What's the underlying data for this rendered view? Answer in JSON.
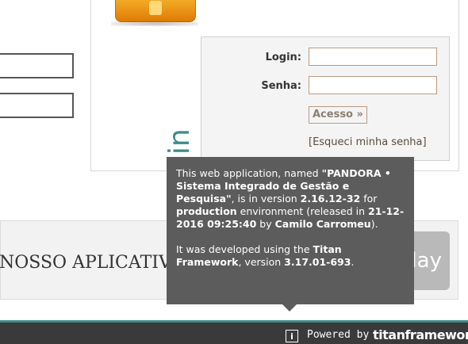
{
  "login_panel": {
    "vertical_title": "login",
    "login_label": "Login:",
    "password_label": "Senha:",
    "login_value": "",
    "password_value": "",
    "access_button": "Acesso »",
    "forgot_link": "[Esqueci minha senha]"
  },
  "band": {
    "text": "NOSSO APLICATIVO",
    "play_label": "lay"
  },
  "tooltip": {
    "t1": "This web application, named ",
    "app_name": "\"PANDORA • Sistema Integrado de Gestão e Pesquisa\"",
    "t2": ", is in version ",
    "version": "2.16.12-32",
    "t3": " for ",
    "environment": "production",
    "t4": " environment (released in ",
    "release_date": "21-12-2016 09:25:40",
    "t5": " by ",
    "author": "Camilo Carromeu",
    "t6": ").",
    "t7": "It was developed using the ",
    "framework": "Titan Framework",
    "t8": ", version ",
    "framework_version": "3.17.01-693",
    "t9": "."
  },
  "footer": {
    "info_icon_glyph": "i",
    "powered_by": "Powered by",
    "brand": "titanframework"
  },
  "colors": {
    "teal_accent": "#3c8a8a",
    "footer_bg": "#3a3a3a",
    "tooltip_bg": "#5c5c5c"
  }
}
